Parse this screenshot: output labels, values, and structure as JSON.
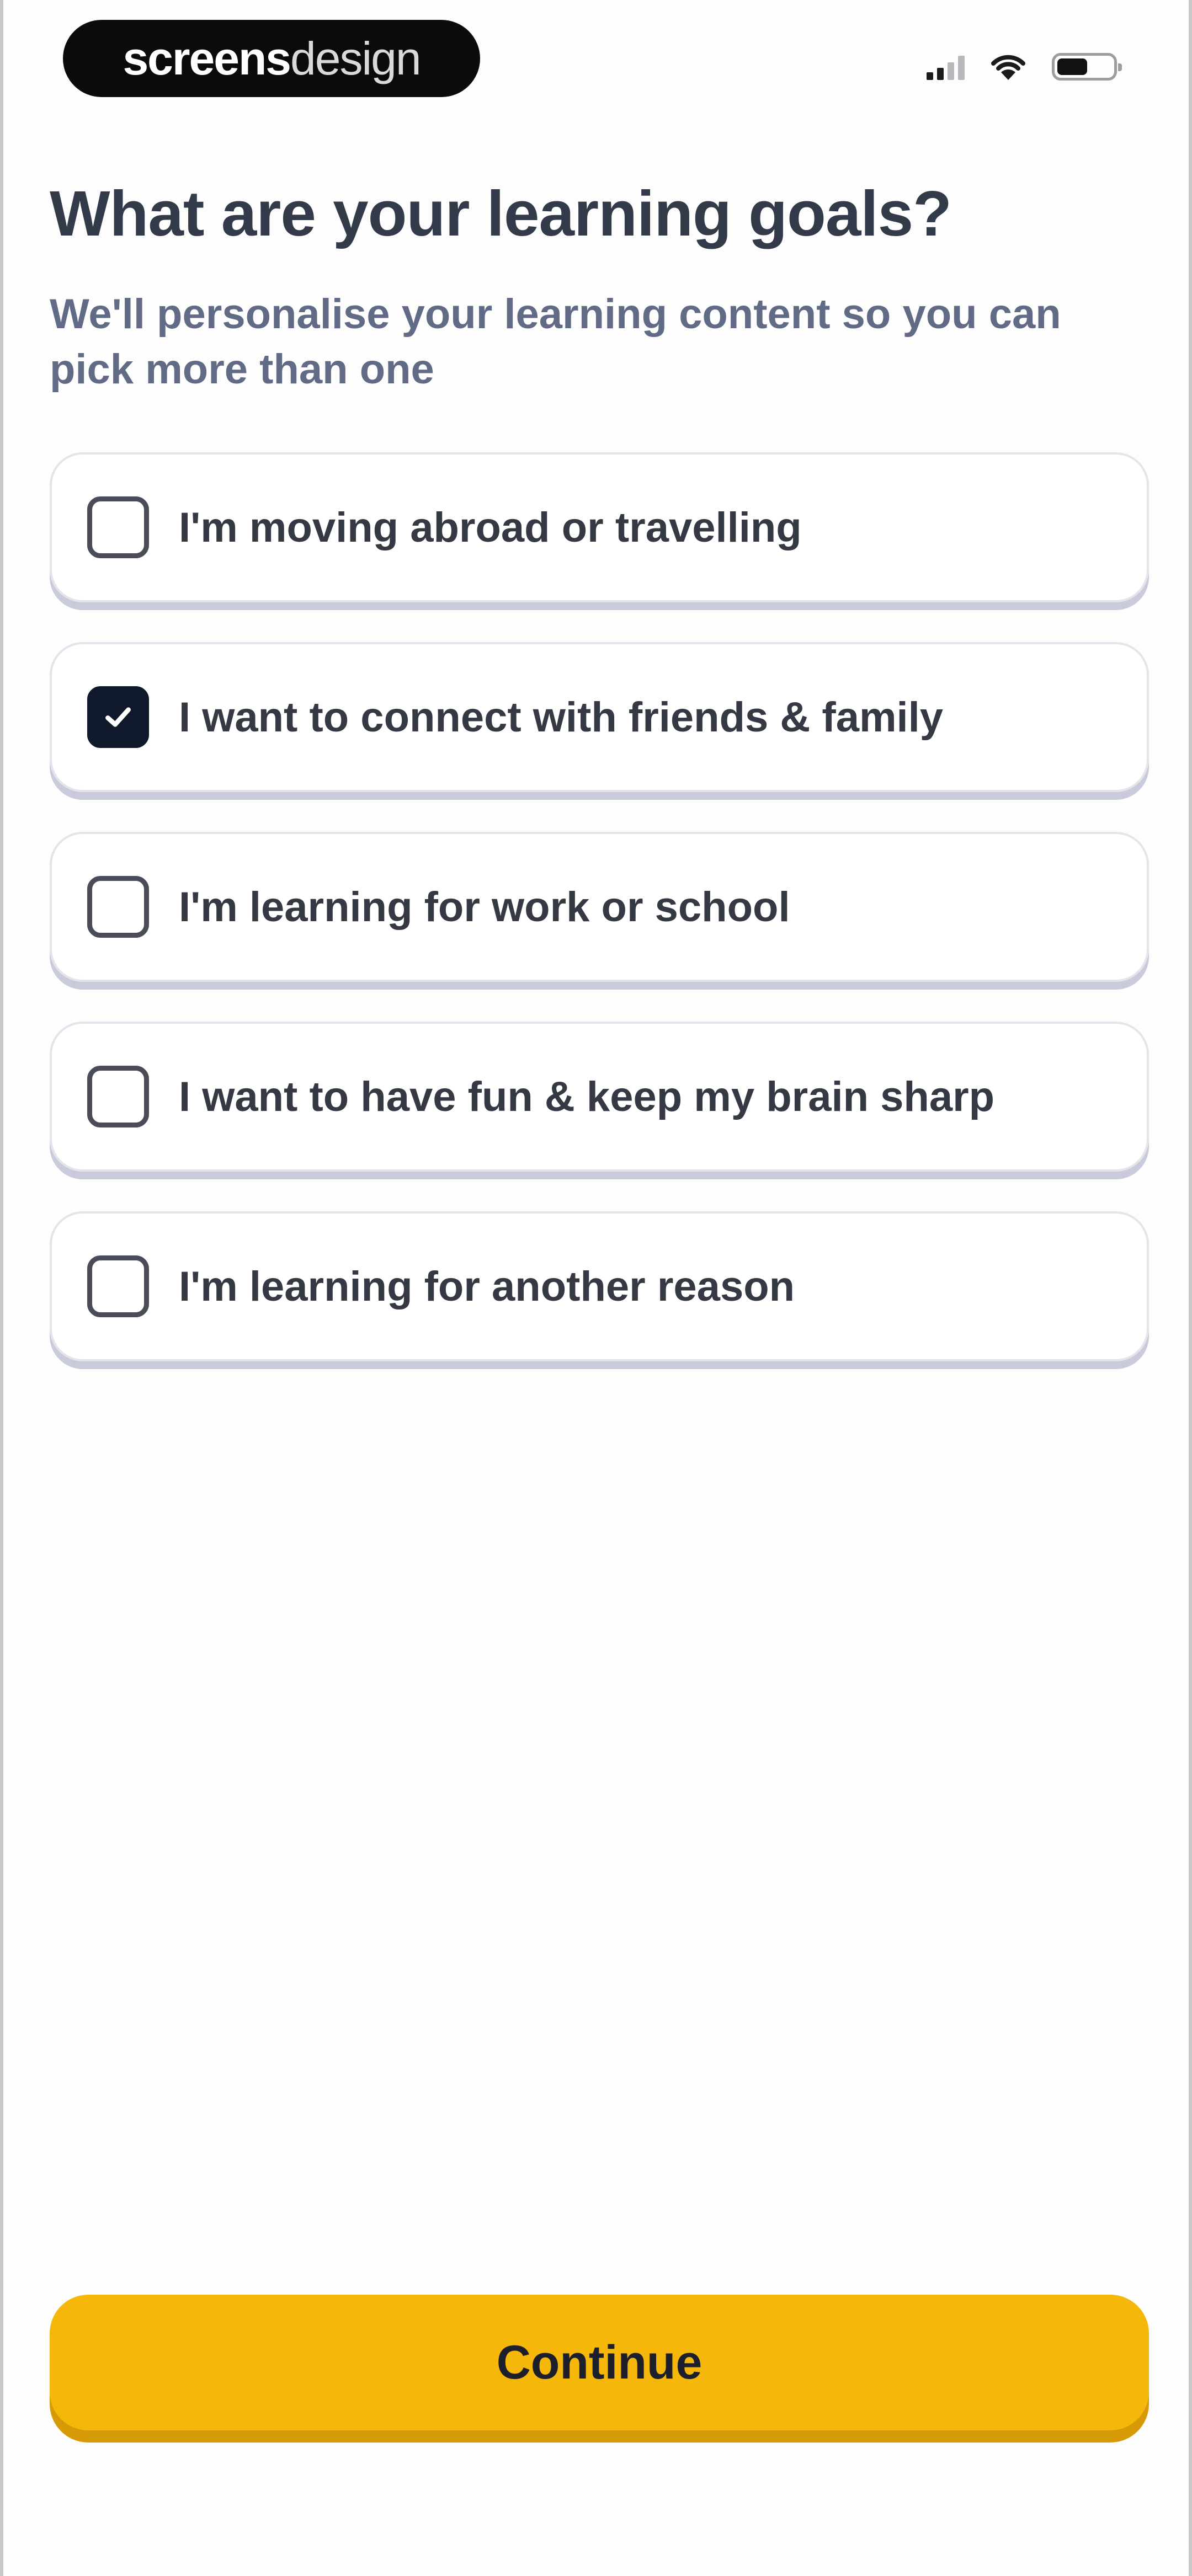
{
  "status_bar": {
    "brand": {
      "strong": "screens",
      "light": "design"
    },
    "icons": [
      "signal-icon",
      "wifi-icon",
      "battery-icon"
    ]
  },
  "header": {
    "title": "What are your learning goals?",
    "subtitle": "We'll personalise your learning content so you can pick more than one"
  },
  "options": [
    {
      "label": "I'm moving abroad or travelling",
      "checked": false
    },
    {
      "label": "I want to connect with friends & family",
      "checked": true
    },
    {
      "label": "I'm learning for work or school",
      "checked": false
    },
    {
      "label": "I want to have fun & keep my brain sharp",
      "checked": false
    },
    {
      "label": "I'm learning for another reason",
      "checked": false
    }
  ],
  "actions": {
    "continue_label": "Continue"
  },
  "colors": {
    "accent": "#f6b70b",
    "checkbox_checked": "#10192b",
    "title": "#333b4b",
    "subtitle": "#616b86"
  }
}
